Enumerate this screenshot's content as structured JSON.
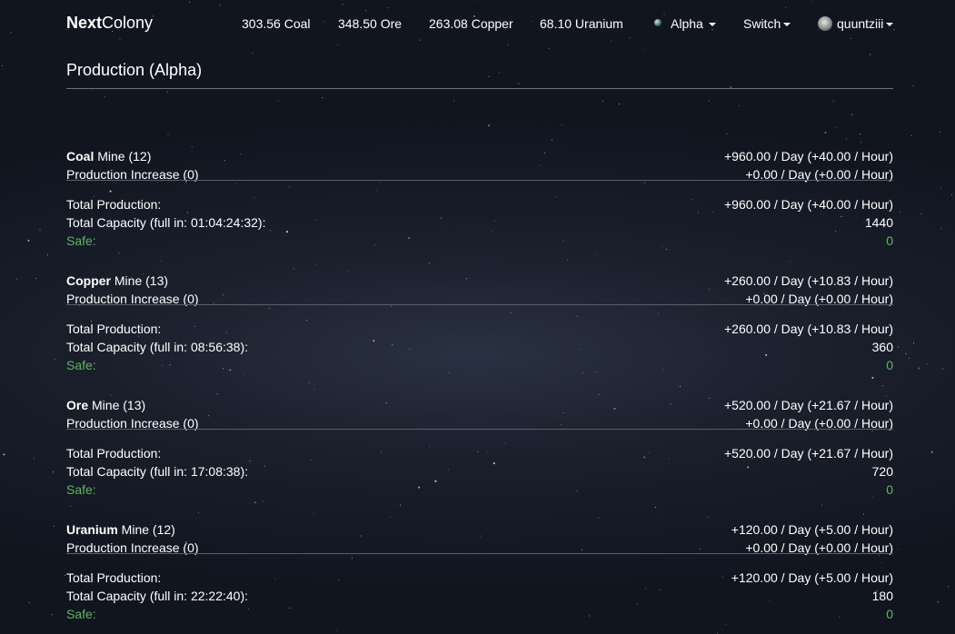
{
  "navbar": {
    "brand_bold": "Next",
    "brand_rest": "Colony",
    "resources": [
      {
        "label": "303.56 Coal"
      },
      {
        "label": "348.50 Ore"
      },
      {
        "label": "263.08 Copper"
      },
      {
        "label": "68.10 Uranium"
      }
    ],
    "planet_menu": "Alpha",
    "switch_menu": "Switch",
    "user_menu": "quuntziii"
  },
  "page": {
    "title": "Production (Alpha)"
  },
  "production": [
    {
      "name": "Coal",
      "mine_suffix": " Mine (12)",
      "mine_rate": "+960.00 / Day (+40.00 / Hour)",
      "increase_label": "Production Increase (0)",
      "increase_rate": "+0.00 / Day (+0.00 / Hour)",
      "total_label": "Total Production:",
      "total_rate": "+960.00 / Day (+40.00 / Hour)",
      "capacity_label": "Total Capacity (full in: 01:04:24:32):",
      "capacity_value": "1440",
      "safe_label": "Safe:",
      "safe_value": "0"
    },
    {
      "name": "Copper",
      "mine_suffix": " Mine (13)",
      "mine_rate": "+260.00 / Day (+10.83 / Hour)",
      "increase_label": "Production Increase (0)",
      "increase_rate": "+0.00 / Day (+0.00 / Hour)",
      "total_label": "Total Production:",
      "total_rate": "+260.00 / Day (+10.83 / Hour)",
      "capacity_label": "Total Capacity (full in: 08:56:38):",
      "capacity_value": "360",
      "safe_label": "Safe:",
      "safe_value": "0"
    },
    {
      "name": "Ore",
      "mine_suffix": " Mine (13)",
      "mine_rate": "+520.00 / Day (+21.67 / Hour)",
      "increase_label": "Production Increase (0)",
      "increase_rate": "+0.00 / Day (+0.00 / Hour)",
      "total_label": "Total Production:",
      "total_rate": "+520.00 / Day (+21.67 / Hour)",
      "capacity_label": "Total Capacity (full in: 17:08:38):",
      "capacity_value": "720",
      "safe_label": "Safe:",
      "safe_value": "0"
    },
    {
      "name": "Uranium",
      "mine_suffix": " Mine (12)",
      "mine_rate": "+120.00 / Day (+5.00 / Hour)",
      "increase_label": "Production Increase (0)",
      "increase_rate": "+0.00 / Day (+0.00 / Hour)",
      "total_label": "Total Production:",
      "total_rate": "+120.00 / Day (+5.00 / Hour)",
      "capacity_label": "Total Capacity (full in: 22:22:40):",
      "capacity_value": "180",
      "safe_label": "Safe:",
      "safe_value": "0"
    }
  ],
  "colors": {
    "background": "#131722",
    "text": "#ffffff",
    "safe_green": "#5cb85c",
    "divider": "#5b5f68"
  }
}
